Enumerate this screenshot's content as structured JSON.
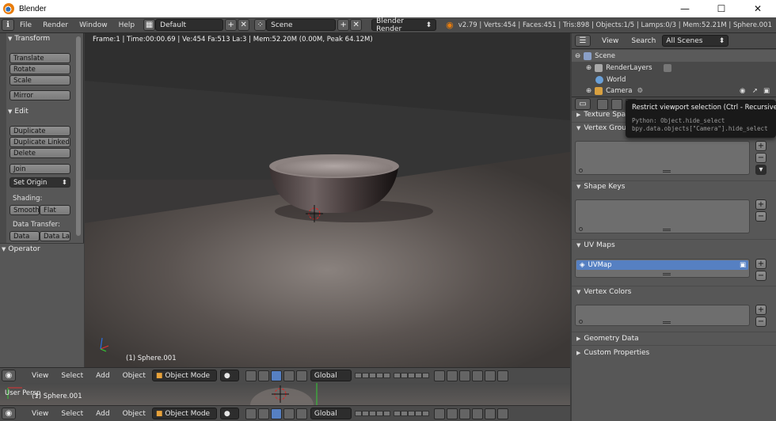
{
  "app": {
    "title": "Blender",
    "controls": [
      "—",
      "☐",
      "✕"
    ]
  },
  "info_menu": [
    "File",
    "Render",
    "Window",
    "Help"
  ],
  "screen_layout": "Default",
  "scene": "Scene",
  "render_engine": "Blender Render",
  "stats": "v2.79 | Verts:454 | Faces:451 | Tris:898 | Objects:1/5 | Lamps:0/3 | Mem:52.21M | Sphere.001",
  "toolshelf": {
    "transform_header": "Transform",
    "translate": "Translate",
    "rotate": "Rotate",
    "scale": "Scale",
    "mirror": "Mirror",
    "edit_header": "Edit",
    "duplicate": "Duplicate",
    "duplicate_linked": "Duplicate Linked",
    "delete": "Delete",
    "join": "Join",
    "set_origin": "Set Origin",
    "shading_label": "Shading:",
    "smooth": "Smooth",
    "flat": "Flat",
    "data_transfer_label": "Data Transfer:",
    "data": "Data",
    "data_layout": "Data La",
    "operator_header": "Operator"
  },
  "viewport": {
    "info": "Frame:1 | Time:00:00.69 | Ve:454 Fa:513 La:3 | Mem:52.20M (0.00M, Peak 64.12M)",
    "object_name": "(1) Sphere.001"
  },
  "view3d_header": {
    "menus": [
      "View",
      "Select",
      "Add",
      "Object"
    ],
    "mode": "Object Mode",
    "orientation": "Global"
  },
  "mini_viewport": {
    "view_label": "User Persp",
    "object_name": "(1) Sphere.001"
  },
  "outliner": {
    "menus": [
      "View",
      "Search"
    ],
    "filter": "All Scenes",
    "items": [
      "Scene",
      "RenderLayers",
      "World",
      "Camera"
    ]
  },
  "properties": {
    "texture_space": "Texture Space",
    "vertex_groups": "Vertex Groups",
    "shape_keys": "Shape Keys",
    "uv_maps": "UV Maps",
    "uv_map_item": "UVMap",
    "vertex_colors": "Vertex Colors",
    "geometry_data": "Geometry Data",
    "custom_properties": "Custom Properties"
  },
  "tooltip": {
    "title": "Restrict viewport selection (Ctrl - Recursive).",
    "python1": "Python: Object.hide_select",
    "python2": "bpy.data.objects[\"Camera\"].hide_select"
  }
}
